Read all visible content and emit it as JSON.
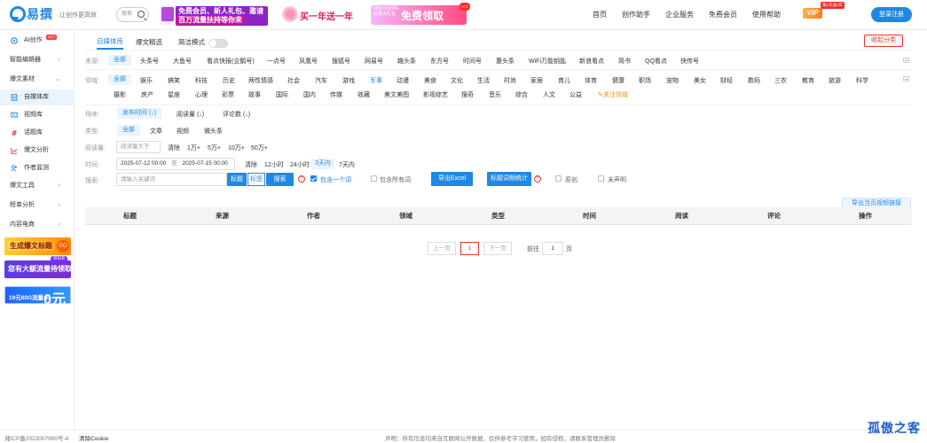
{
  "header": {
    "logo_text": "易撰",
    "slogan": "让创作更高效",
    "search_placeholder": "搜索",
    "banner1_line1": "免费会员、新人礼包、邀请好友",
    "banner1_line2": "百万流量扶持等你来",
    "banner2_text": "买一年送一年",
    "banner3_small": "29元=1000G流量大礼包",
    "banner3_big": "免费领取",
    "banner3_hot": "HOT",
    "nav": [
      "首页",
      "创作助手",
      "企业服务",
      "免费会员",
      "使用帮助"
    ],
    "vip_label": "VIP",
    "vip_badge": "限1年送1年",
    "login_label": "登录注册"
  },
  "sidebar": {
    "items": [
      {
        "label": "AI创作",
        "tag": "HOT"
      },
      {
        "label": "智能编辑器"
      },
      {
        "label": "爆文素材"
      },
      {
        "label": "自媒体库"
      },
      {
        "label": "视频库"
      },
      {
        "label": "话题库"
      },
      {
        "label": "爆文分析"
      },
      {
        "label": "作者监测"
      },
      {
        "label": "爆文工具"
      },
      {
        "label": "榜单分析"
      },
      {
        "label": "内容电商"
      }
    ],
    "ads": {
      "ad1": "生成爆文标题",
      "ad1_go": "GO",
      "ad2": "您有大额流量待领取",
      "ad2_cap": "80GB",
      "ad3": "19元80G流量卡",
      "ad3_big": "0元"
    }
  },
  "main": {
    "tabs": [
      "自媒体库",
      "爆文精选"
    ],
    "simple_mode": "简洁模式",
    "collect": "收起分类",
    "source_label": "来源:",
    "sources": [
      "全部",
      "头条号",
      "大鱼号",
      "看点快报(企鹅号)",
      "一点号",
      "凤凰号",
      "搜狐号",
      "网易号",
      "趣头条",
      "东方号",
      "时间号",
      "惠头条",
      "WiFi万能钥匙",
      "新浪看点",
      "简书",
      "QQ看点",
      "快传号"
    ],
    "domain_label": "领域:",
    "domains_row1": [
      "全部",
      "娱乐",
      "搞笑",
      "科技",
      "历史",
      "两性情感",
      "社会",
      "汽车",
      "游戏",
      "军事",
      "动漫",
      "美食",
      "文化",
      "生活",
      "时尚",
      "家居",
      "育儿",
      "体育",
      "健康",
      "职场",
      "宠物",
      "美女",
      "财经",
      "数码",
      "三农",
      "教育",
      "旅游",
      "科学"
    ],
    "domains_row2": [
      "摄影",
      "房产",
      "星座",
      "心理",
      "彩票",
      "故事",
      "国际",
      "国内",
      "传媒",
      "收藏",
      "美文美图",
      "影视综艺",
      "搜奇",
      "音乐",
      "综合",
      "人文",
      "公益"
    ],
    "follow_domain": "关注领域",
    "sort_label": "排序:",
    "sorts": [
      "发布时间 (↓)",
      "阅读量 (↓)",
      "评论数 (↓)"
    ],
    "type_label": "类型:",
    "types": [
      "全部",
      "文章",
      "视频",
      "微头条"
    ],
    "reads_label": "阅读量:",
    "reads_placeholder": "阅读量大于",
    "reads_opts": [
      "清除",
      "1万+",
      "5万+",
      "10万+",
      "50万+"
    ],
    "time_label": "时间:",
    "date_start": "2025-07-12 00:00",
    "date_sep": "至",
    "date_end": "2025-07-15 00:00",
    "time_opts": [
      "清除",
      "12小时",
      "24小时",
      "3天内",
      "7天内"
    ],
    "search_label": "搜索:",
    "search_placeholder": "请输入关键词",
    "search_modes": [
      "标题",
      "标签"
    ],
    "search_btn": "搜索",
    "q1": "?",
    "include_one": "包含一个词",
    "include_all": "包含所有词",
    "export_excel": "导出Excel",
    "title_stats": "标题词频统计",
    "q2": "?",
    "original": "原创",
    "undeclared": "未声明",
    "export_video": "导出当页视频链接",
    "columns": [
      "标题",
      "来源",
      "作者",
      "领域",
      "类型",
      "时间",
      "阅读",
      "评论",
      "操作"
    ],
    "pager": {
      "prev": "上一页",
      "current": "1",
      "next": "下一页",
      "goto": "前往",
      "page_value": "1",
      "page_unit": "页"
    }
  },
  "footer": {
    "icp": "湘ICP备2023007990号-4",
    "clear_cookie": "清除Cookie",
    "notice": "声明：所有信息均来自互联网公开数据，仅供参考学习使用，如有侵权，请联系管理员删除"
  },
  "watermark": "孤傲之客"
}
